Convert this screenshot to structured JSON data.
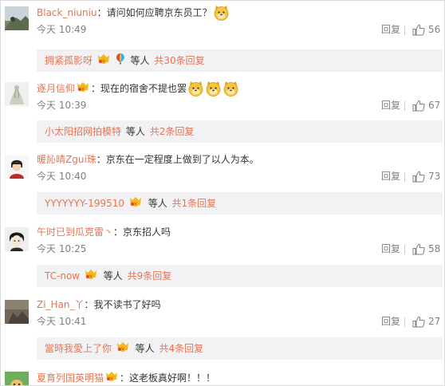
{
  "comments": [
    {
      "username": "Black_niuniu",
      "text": "请问如何应聘京东员工？",
      "time": "今天 10:49",
      "reply_label": "回复",
      "likes": "56",
      "reply_preview": {
        "user": "拥紧孤影呀",
        "etc": "等人",
        "total": "共30条回复"
      }
    },
    {
      "username": "逐月信仰",
      "text": "现在的宿舍不提也罢",
      "time": "今天 10:39",
      "reply_label": "回复",
      "likes": "67",
      "reply_preview": {
        "user": "小太阳招网拍模特",
        "etc": "等人",
        "total": "共2条回复"
      }
    },
    {
      "username": "暖訫晴Zgui珠",
      "text": "京东在一定程度上做到了以人为本。",
      "time": "今天 10:40",
      "reply_label": "回复",
      "likes": "73",
      "reply_preview": {
        "user": "YYYYYYY-199510",
        "etc": "等人",
        "total": "共1条回复"
      }
    },
    {
      "username": "午时已到瓜克雷丶",
      "text": "京东招人吗",
      "time": "今天 10:25",
      "reply_label": "回复",
      "likes": "58",
      "reply_preview": {
        "user": "TC-now",
        "etc": "等人",
        "total": "共9条回复"
      }
    },
    {
      "username": "Zi_Han_丫",
      "text": "我不读书了好吗",
      "time": "今天 10:41",
      "reply_label": "回复",
      "likes": "27",
      "reply_preview": {
        "user": "當時我愛上了你",
        "etc": "等人",
        "total": "共4条回复"
      }
    },
    {
      "username": "夏育列国英明猫",
      "text": "这老板真好啊！！！"
    }
  ],
  "colors": {
    "username": "#eb7350",
    "meta": "#808080",
    "reply_bg": "#f2f2f5"
  }
}
